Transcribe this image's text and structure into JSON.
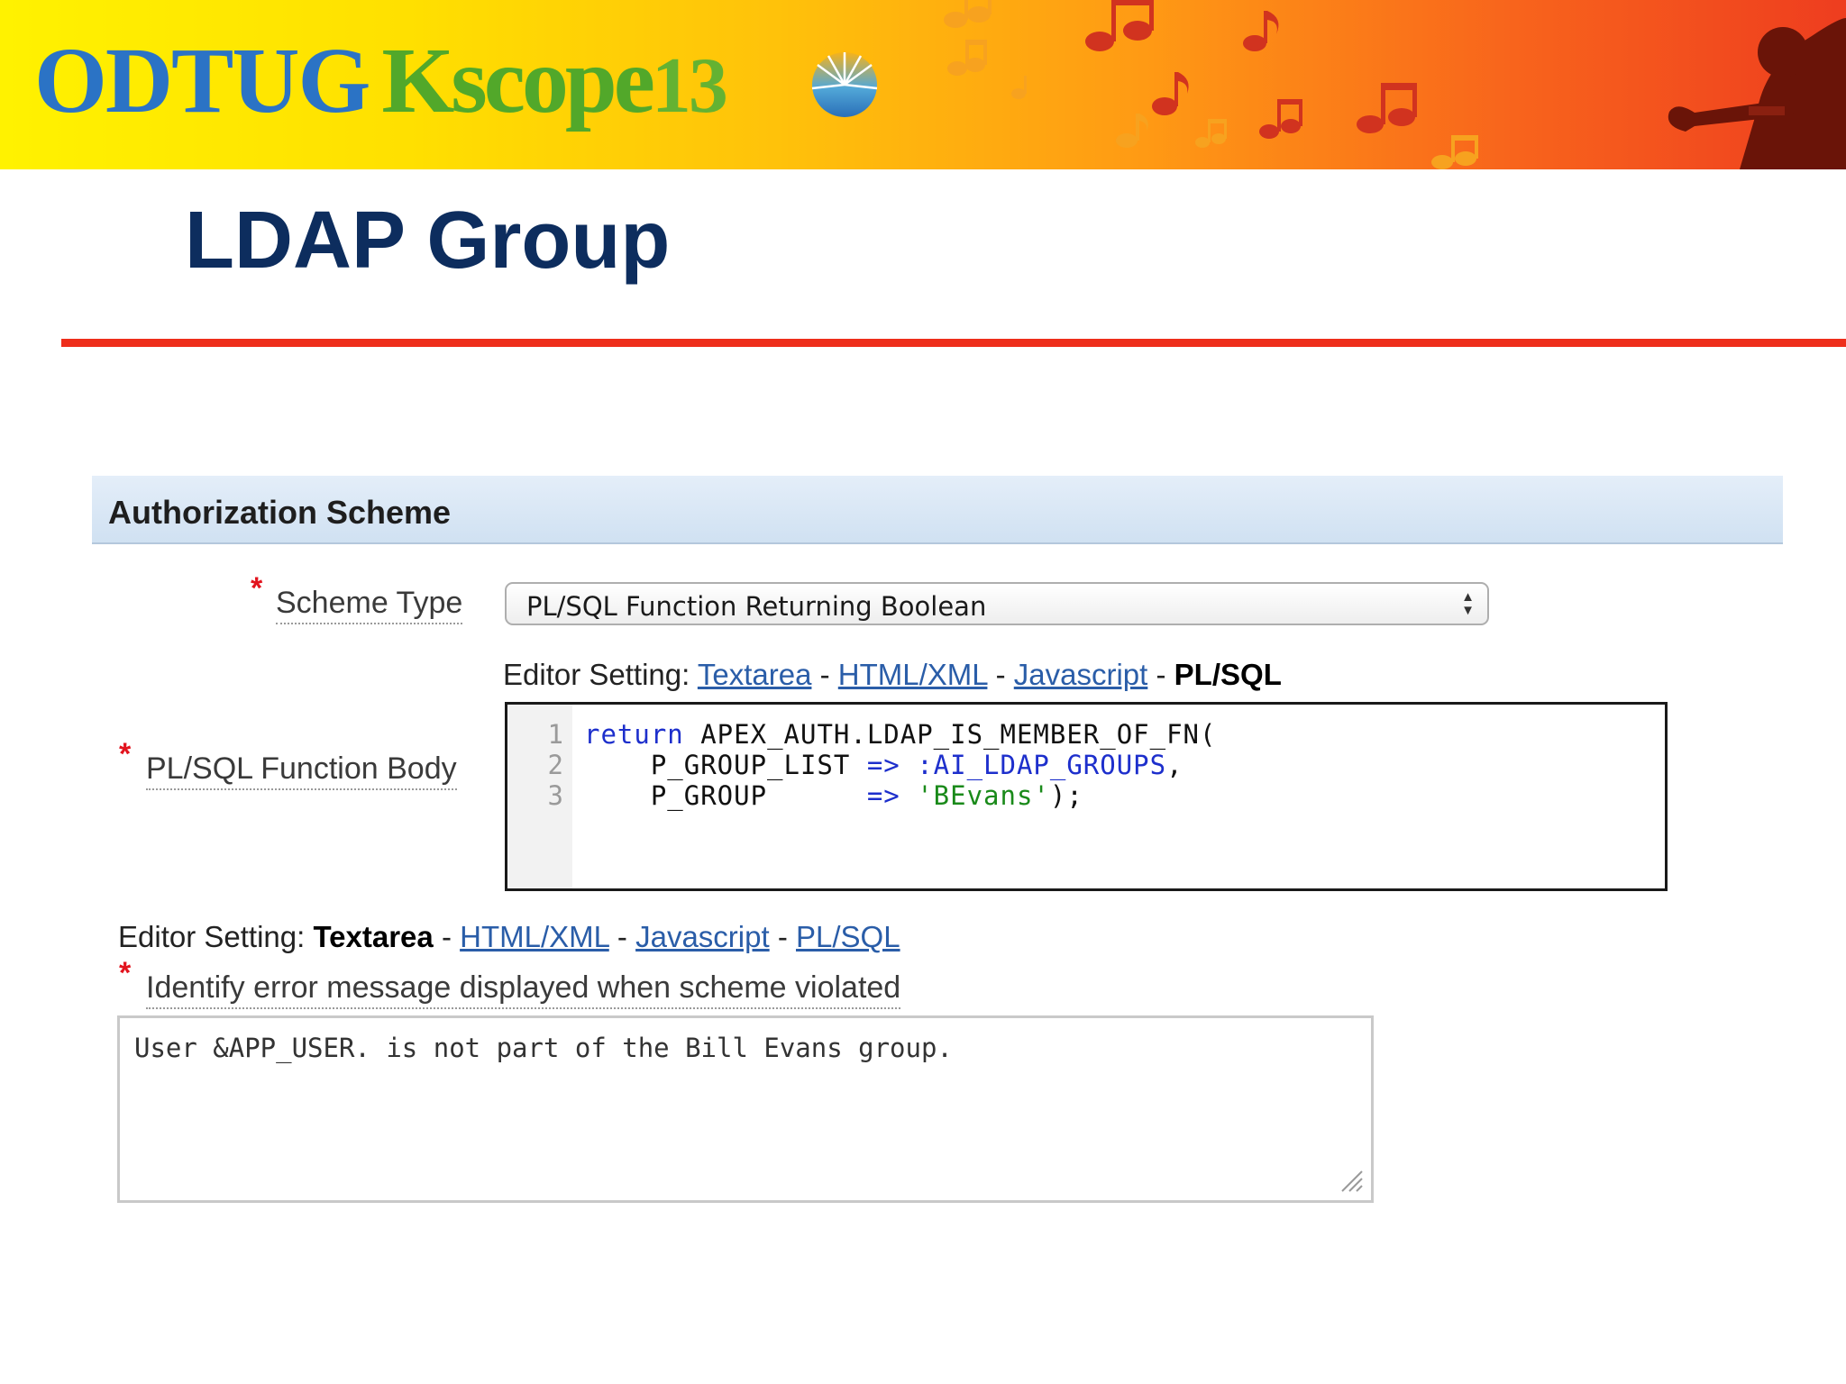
{
  "banner": {
    "logo_odtug": "ODTUG",
    "logo_kscope": "Kscope",
    "logo_year": "13",
    "icons": [
      "music-notes",
      "trumpet-player-silhouette",
      "sunburst-logo"
    ]
  },
  "slide": {
    "title": "LDAP Group"
  },
  "region": {
    "title": "Authorization Scheme"
  },
  "scheme_type": {
    "label": "Scheme Type",
    "required_mark": "*",
    "selected": "PL/SQL Function Returning Boolean"
  },
  "function_body": {
    "label": "PL/SQL Function Body",
    "required_mark": "*",
    "editor_setting": {
      "prefix": "Editor Setting:",
      "options": [
        "Textarea",
        "HTML/XML",
        "Javascript",
        "PL/SQL"
      ],
      "active": "PL/SQL",
      "separator": "-"
    },
    "line_numbers": [
      "1",
      "2",
      "3"
    ],
    "code": [
      [
        "return",
        " APEX_AUTH.LDAP_IS_MEMBER_OF_FN("
      ],
      [
        "    P_GROUP_LIST ",
        "=>",
        " ",
        ":AI_LDAP_GROUPS",
        ","
      ],
      [
        "    P_GROUP      ",
        "=>",
        " ",
        "'BEvans'",
        ");"
      ]
    ]
  },
  "error_message": {
    "editor_setting": {
      "prefix": "Editor Setting:",
      "options": [
        "Textarea",
        "HTML/XML",
        "Javascript",
        "PL/SQL"
      ],
      "active": "Textarea",
      "separator": "-"
    },
    "label": "Identify error message displayed when scheme violated",
    "required_mark": "*",
    "value": "User &APP_USER. is not part of the Bill Evans group."
  },
  "colors": {
    "title": "#0d2d5e",
    "rule": "#ee2e1b",
    "link": "#2a5da8",
    "required": "#e2141e",
    "keyword": "#1d2fcc",
    "string": "#1a8a1a"
  }
}
